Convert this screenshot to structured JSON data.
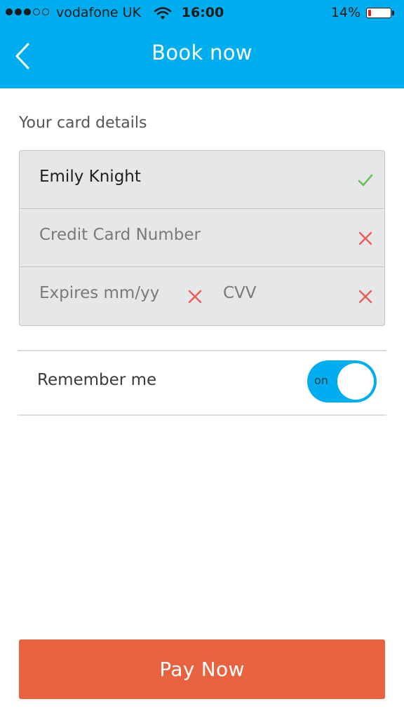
{
  "status_bar": {
    "carrier": "vodafone UK",
    "time": "16:00",
    "battery": "14%",
    "battery_level": 0.14,
    "signal_bars_filled": 3,
    "signal_bars_total": 5
  },
  "nav": {
    "title": "Book now",
    "back_icon": "chevron-left-icon"
  },
  "card_details": {
    "section_label": "Your card details",
    "name_value": "Emily Knight",
    "card_number_placeholder": "Credit Card Number",
    "expiry_placeholder": "Expires mm/yy",
    "cvv_placeholder": "CVV",
    "valid_icon": "check-icon",
    "invalid_icon": "cross-icon"
  },
  "remember": {
    "label": "Remember me",
    "toggle_text": "on",
    "enabled": true
  },
  "pay_button": {
    "label": "Pay Now"
  },
  "colors": {
    "accent": "#00aeef",
    "pay_button": "#e8623f",
    "valid": "#6cbf5a",
    "invalid": "#e8605c",
    "field_background": "#e6e7e9"
  }
}
